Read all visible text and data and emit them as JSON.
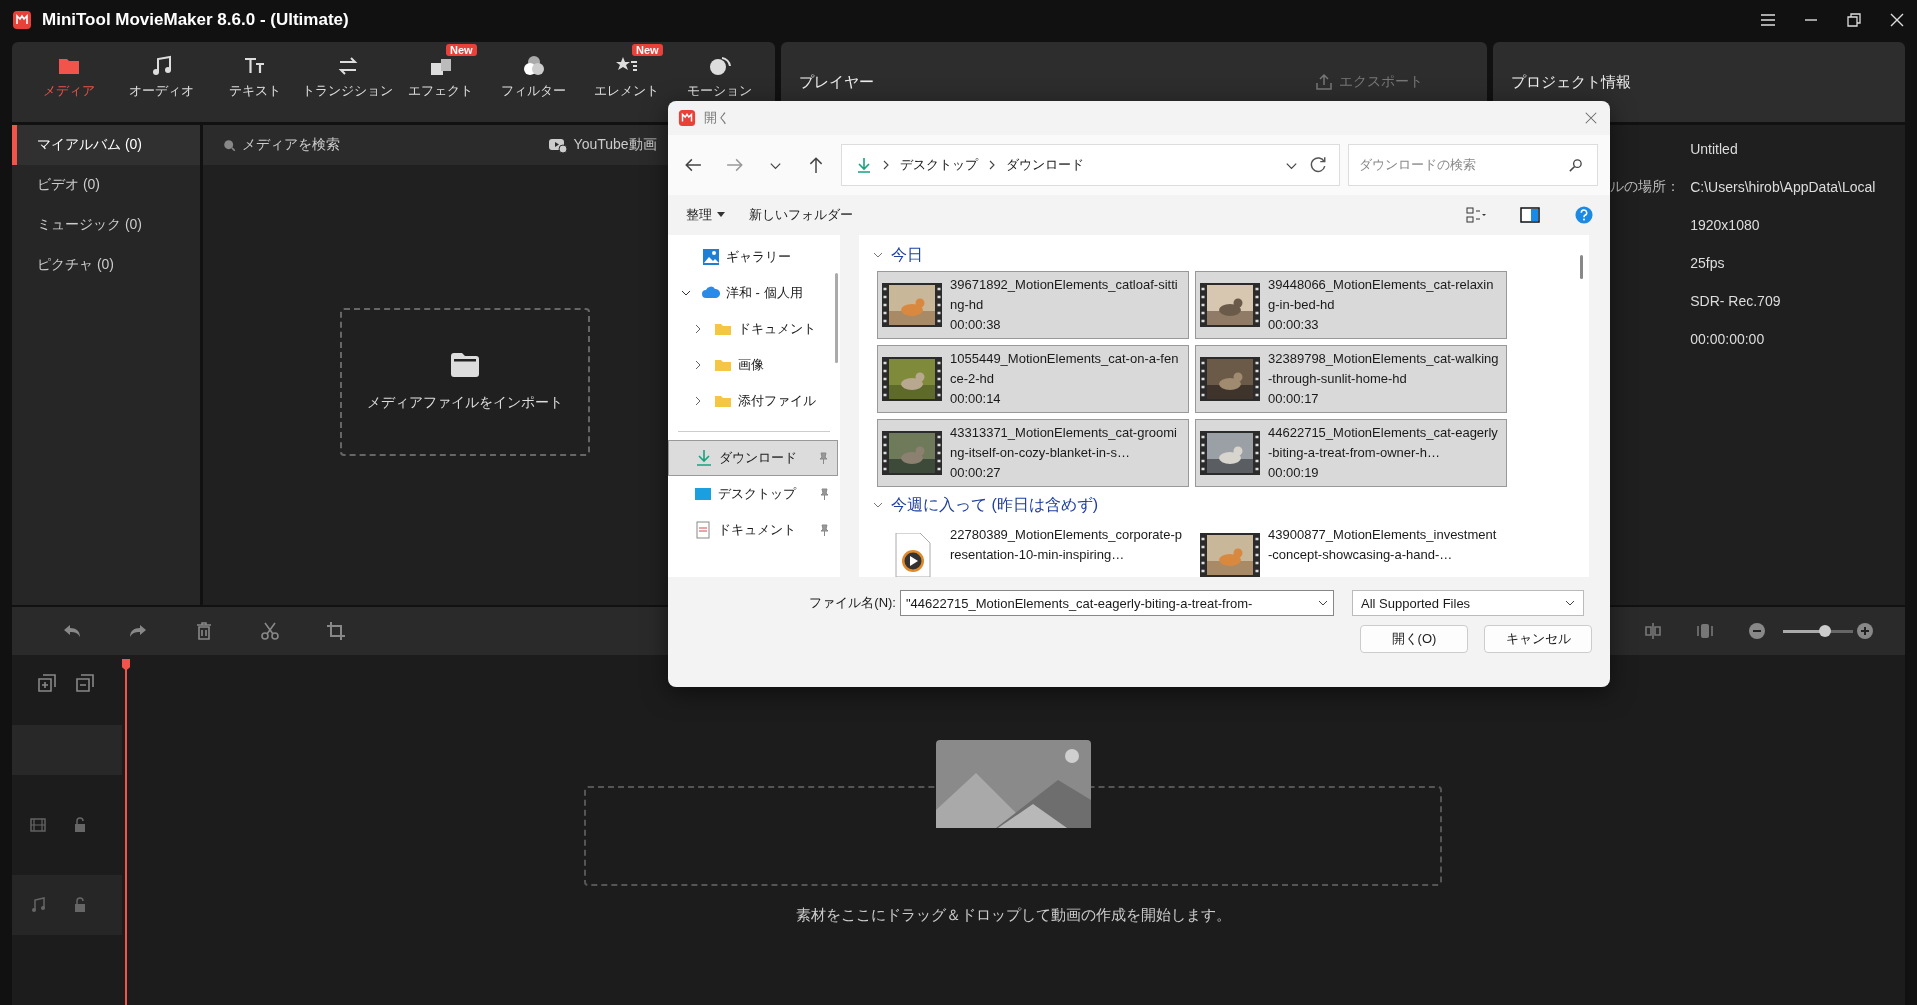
{
  "app": {
    "title": "MiniTool MovieMaker 8.6.0 - (Ultimate)"
  },
  "toolbar": [
    {
      "label": "メディア",
      "selected": true
    },
    {
      "label": "オーディオ",
      "selected": false
    },
    {
      "label": "テキスト",
      "selected": false
    },
    {
      "label": "トランジション",
      "selected": false
    },
    {
      "label": "エフェクト",
      "selected": false,
      "badge": "New"
    },
    {
      "label": "フィルター",
      "selected": false
    },
    {
      "label": "エレメント",
      "selected": false,
      "badge": "New"
    },
    {
      "label": "モーション",
      "selected": false
    }
  ],
  "library": {
    "categories": [
      {
        "label": "マイアルバム (0)",
        "selected": true
      },
      {
        "label": "ビデオ (0)",
        "selected": false
      },
      {
        "label": "ミュージック (0)",
        "selected": false
      },
      {
        "label": "ピクチャ (0)",
        "selected": false
      }
    ],
    "search_placeholder": "メディアを検索",
    "youtube_label": "YouTube動画",
    "import_label": "メディアファイルをインポート"
  },
  "player": {
    "title": "プレイヤー",
    "export_label": "エクスポート",
    "export_disabled": true
  },
  "project_info": {
    "title": "プロジェクト情報",
    "rows": [
      {
        "value": "Untitled"
      },
      {
        "label": "ルの場所：",
        "value": "C:\\Users\\hirob\\AppData\\Local"
      },
      {
        "value": "1920x1080"
      },
      {
        "value": "25fps"
      },
      {
        "value": "SDR- Rec.709"
      },
      {
        "value": "00:00:00:00"
      }
    ]
  },
  "timeline": {
    "zoom": {
      "level": 0.6
    },
    "drop_hint": "素材をここにドラッグ＆ドロップして動画の作成を開始します。"
  },
  "dialog": {
    "title": "開く",
    "path": [
      "デスクトップ",
      "ダウンロード"
    ],
    "search_placeholder": "ダウンロードの検索",
    "commands": [
      "整理",
      "新しいフォルダー"
    ],
    "nav": [
      {
        "label": "ギャラリー",
        "kind": "gallery",
        "selected": false
      },
      {
        "label": "洋和 - 個人用",
        "kind": "cloud",
        "selected": false,
        "expanded": true,
        "children": [
          {
            "label": "ドキュメント",
            "kind": "folder",
            "selected": false,
            "expanded": false
          },
          {
            "label": "画像",
            "kind": "folder",
            "selected": false,
            "expanded": false
          },
          {
            "label": "添付ファイル",
            "kind": "folder",
            "selected": false,
            "expanded": false
          }
        ]
      }
    ],
    "quick_access": [
      {
        "label": "ダウンロード",
        "kind": "download",
        "selected": true,
        "pinned": true
      },
      {
        "label": "デスクトップ",
        "kind": "desktop",
        "selected": false,
        "pinned": true
      },
      {
        "label": "ドキュメント",
        "kind": "document",
        "selected": false,
        "pinned": true
      }
    ],
    "groups": [
      {
        "title": "今日",
        "expanded": true,
        "files": [
          {
            "name": "39671892_MotionElements_catloaf-sitting-hd",
            "duration": "00:00:38",
            "kind": "video",
            "selected": true
          },
          {
            "name": "39448066_MotionElements_cat-relaxing-in-bed-hd",
            "duration": "00:00:33",
            "kind": "video",
            "selected": true
          },
          {
            "name": "1055449_MotionElements_cat-on-a-fence-2-hd",
            "duration": "00:00:14",
            "kind": "video",
            "selected": true
          },
          {
            "name": "32389798_MotionElements_cat-walking-through-sunlit-home-hd",
            "duration": "00:00:17",
            "kind": "video",
            "selected": true
          },
          {
            "name": "43313371_MotionElements_cat-grooming-itself-on-cozy-blanket-in-s…",
            "duration": "00:00:27",
            "kind": "video",
            "selected": true
          },
          {
            "name": "44622715_MotionElements_cat-eagerly-biting-a-treat-from-owner-h…",
            "duration": "00:00:19",
            "kind": "video",
            "selected": true
          }
        ]
      },
      {
        "title": "今週に入って (昨日は含めず)",
        "expanded": true,
        "files": [
          {
            "name": "22780389_MotionElements_corporate-presentation-10-min-inspiring…",
            "kind": "media",
            "selected": false
          },
          {
            "name": "43900877_MotionElements_investment-concept-showcasing-a-hand-…",
            "kind": "video",
            "selected": false
          }
        ]
      }
    ],
    "file_name_label": "ファイル名(N):",
    "file_name": "\"44622715_MotionElements_cat-eagerly-biting-a-treat-from-",
    "file_type": "All Supported Files",
    "buttons": [
      "開く(O)",
      "キャンセル"
    ]
  }
}
